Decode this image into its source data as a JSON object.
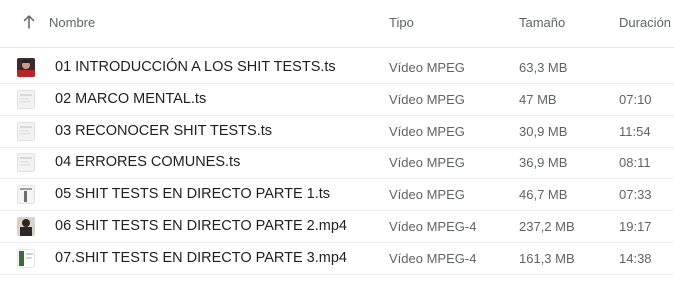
{
  "columns": {
    "name": "Nombre",
    "type": "Tipo",
    "size": "Tamaño",
    "duration": "Duración"
  },
  "sort": {
    "column": "name",
    "direction": "ascending",
    "icon": "arrow-up-icon"
  },
  "files": [
    {
      "name": "01 INTRODUCCIÓN A LOS SHIT TESTS.ts",
      "type": "Vídeo MPEG",
      "size": "63,3 MB",
      "duration": "",
      "thumb": "video-thumbnail-person-red"
    },
    {
      "name": "02 MARCO MENTAL.ts",
      "type": "Vídeo MPEG",
      "size": "47 MB",
      "duration": "07:10",
      "thumb": "video-thumbnail-slide"
    },
    {
      "name": "03 RECONOCER SHIT TESTS.ts",
      "type": "Vídeo MPEG",
      "size": "30,9 MB",
      "duration": "11:54",
      "thumb": "video-thumbnail-slide"
    },
    {
      "name": "04 ERRORES COMUNES.ts",
      "type": "Vídeo MPEG",
      "size": "36,9 MB",
      "duration": "08:11",
      "thumb": "video-thumbnail-slide"
    },
    {
      "name": "05 SHIT TESTS EN DIRECTO PARTE 1.ts",
      "type": "Vídeo MPEG",
      "size": "46,7 MB",
      "duration": "07:33",
      "thumb": "video-thumbnail-slide-dark"
    },
    {
      "name": "06 SHIT TESTS EN DIRECTO PARTE 2.mp4",
      "type": "Vídeo MPEG-4",
      "size": "237,2 MB",
      "duration": "19:17",
      "thumb": "video-thumbnail-person"
    },
    {
      "name": "07.SHIT TESTS EN DIRECTO PARTE 3.mp4",
      "type": "Vídeo MPEG-4",
      "size": "161,3 MB",
      "duration": "14:38",
      "thumb": "video-thumbnail-frame"
    }
  ]
}
